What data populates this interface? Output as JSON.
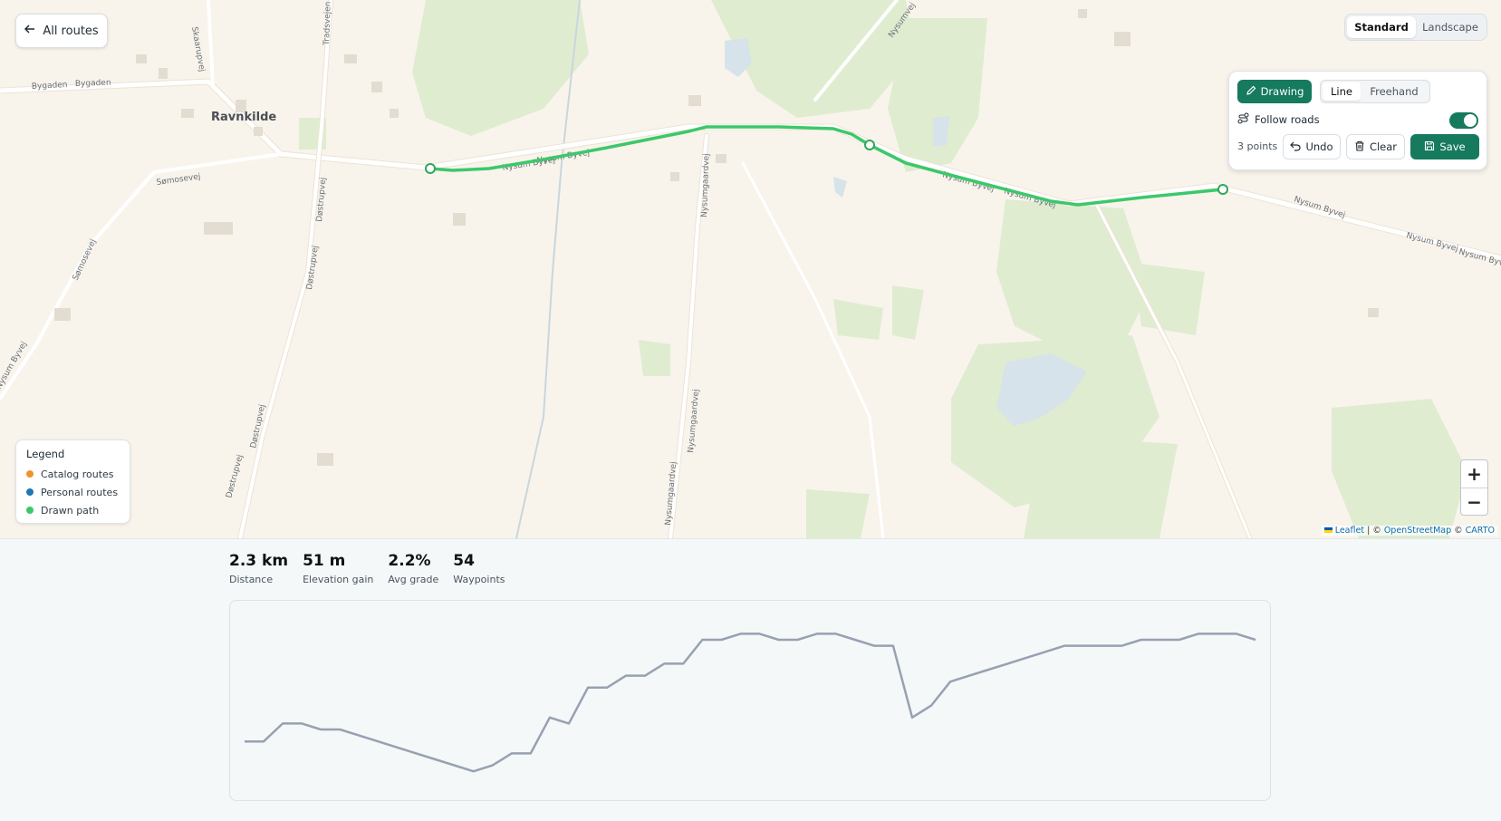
{
  "nav": {
    "back_label": "All routes"
  },
  "view_toggle": {
    "options": [
      "Standard",
      "Landscape"
    ],
    "selected": "Standard"
  },
  "drawing_panel": {
    "drawing_label": "Drawing",
    "modes": [
      "Line",
      "Freehand"
    ],
    "selected_mode": "Line",
    "follow_roads_label": "Follow roads",
    "follow_roads_on": true,
    "points_label": "3 points",
    "undo_label": "Undo",
    "clear_label": "Clear",
    "save_label": "Save"
  },
  "legend": {
    "title": "Legend",
    "items": [
      {
        "label": "Catalog routes",
        "color": "#f0932b"
      },
      {
        "label": "Personal routes",
        "color": "#1f77b4"
      },
      {
        "label": "Drawn path",
        "color": "#3cc86a"
      }
    ]
  },
  "map": {
    "town": "Ravnkilde",
    "roads": [
      "Bygaden",
      "Bygaden",
      "Skaarupvej",
      "Tradsvejen",
      "Sømosevej",
      "Sømosevej",
      "Døstrupvej",
      "Døstrupvej",
      "Døstrupvej",
      "Døstrupvej",
      "Nysum Byvej",
      "Nysum Byvej",
      "Nysum Byvej",
      "Nysum Byvej",
      "Nysum Byvej",
      "Nysum Byvej",
      "Nysum Byvej",
      "Nysum Byvej",
      "Nysumgaardvej",
      "Nysumgaardvej",
      "Nysumgaardvej",
      "Nysumvej"
    ],
    "route_color": "#3cc86a",
    "zoom_in": "+",
    "zoom_out": "−",
    "attribution": {
      "leaflet": "Leaflet",
      "osm": "OpenStreetMap",
      "carto": "CARTO",
      "sep1": " | © ",
      "sep2": " © "
    }
  },
  "stats": [
    {
      "value": "2.3 km",
      "label": "Distance"
    },
    {
      "value": "51 m",
      "label": "Elevation gain"
    },
    {
      "value": "2.2%",
      "label": "Avg grade"
    },
    {
      "value": "54",
      "label": "Waypoints"
    }
  ],
  "chart_data": {
    "type": "line",
    "series": [
      {
        "color": "#98a1b2",
        "values": [
          28,
          28,
          31,
          31,
          30,
          30,
          29,
          28,
          27,
          26,
          25,
          24,
          23,
          24,
          26,
          26,
          32,
          31,
          37,
          37,
          39,
          39,
          41,
          41,
          45,
          45,
          46,
          46,
          45,
          45,
          46,
          46,
          45,
          44,
          44,
          32,
          34,
          38,
          39,
          40,
          41,
          42,
          43,
          44,
          44,
          44,
          44,
          45,
          45,
          45,
          46,
          46,
          46,
          45
        ]
      }
    ],
    "ylim": [
      20,
      50
    ],
    "grid": false
  }
}
